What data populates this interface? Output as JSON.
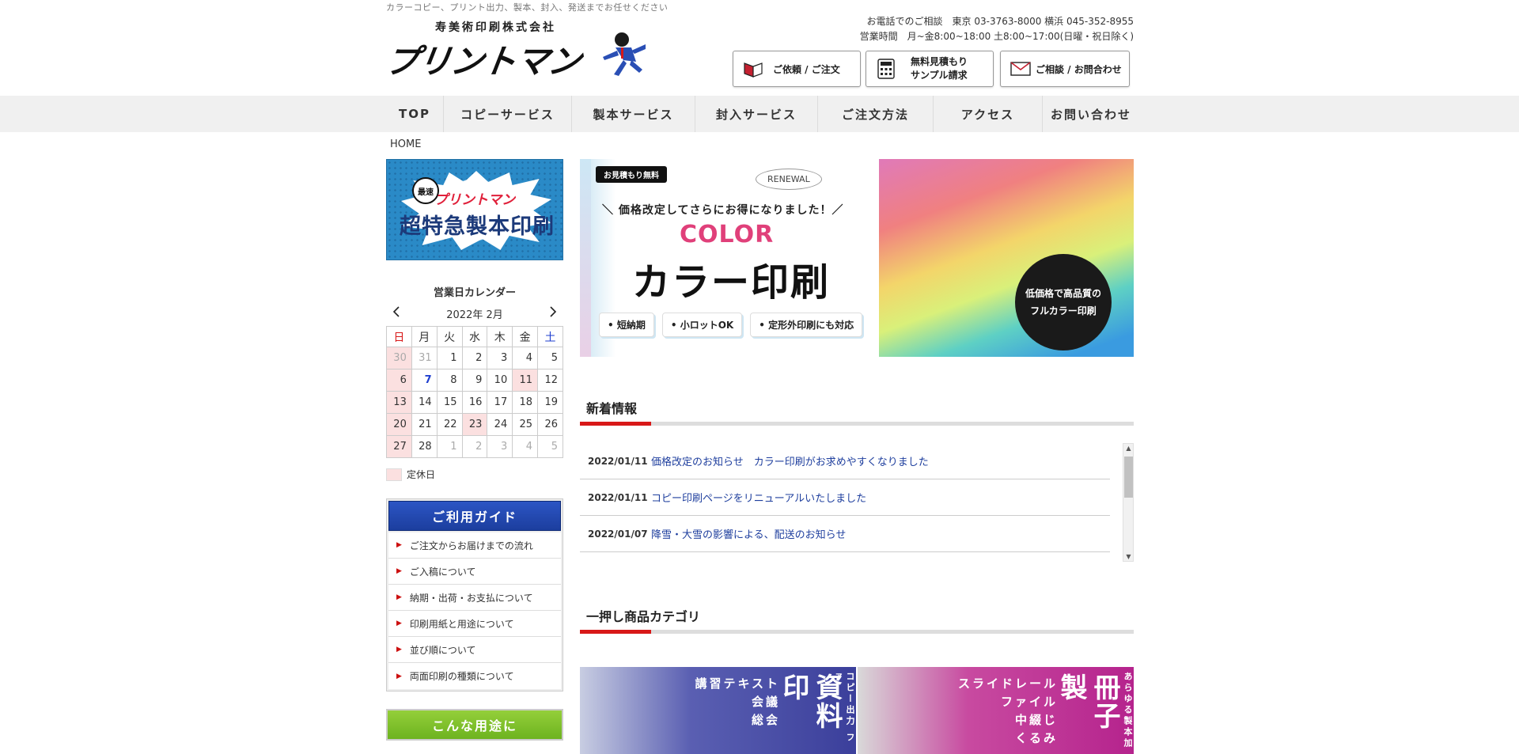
{
  "header": {
    "tagline": "カラーコピー、プリント出力、製本、封入、発送までお任せください",
    "company": "寿美術印刷株式会社",
    "logo": "プリントマン",
    "contact_line1": "お電話でのご相談　東京 03-3763-8000 横浜 045-352-8955",
    "contact_line2": "営業時間　月~金8:00~18:00 土8:00~17:00(日曜・祝日除く)",
    "btn_order": "ご依頼 / ご注文",
    "btn_estimate_1": "無料見積もり",
    "btn_estimate_2": "サンプル請求",
    "btn_contact": "ご相談 / お問合わせ"
  },
  "nav": {
    "items": [
      "TOP",
      "コピーサービス",
      "製本サービス",
      "封入サービス",
      "ご注文方法",
      "アクセス",
      "お問い合わせ"
    ]
  },
  "breadcrumb": "HOME",
  "sidebar": {
    "promo_badge": "最速",
    "promo_brand": "プリントマン",
    "promo_title": "超特急製本印刷",
    "calendar_title": "営業日カレンダー",
    "calendar_month": "2022年 2月",
    "weekdays": [
      "日",
      "月",
      "火",
      "水",
      "木",
      "金",
      "土"
    ],
    "weeks": [
      [
        "30",
        "31",
        "1",
        "2",
        "3",
        "4",
        "5"
      ],
      [
        "6",
        "7",
        "8",
        "9",
        "10",
        "11",
        "12"
      ],
      [
        "13",
        "14",
        "15",
        "16",
        "17",
        "18",
        "19"
      ],
      [
        "20",
        "21",
        "22",
        "23",
        "24",
        "25",
        "26"
      ],
      [
        "27",
        "28",
        "1",
        "2",
        "3",
        "4",
        "5"
      ]
    ],
    "legend": "定休日",
    "guide_title": "ご利用ガイド",
    "guide_items": [
      "ご注文からお届けまでの流れ",
      "ご入稿について",
      "納期・出荷・お支払について",
      "印刷用紙と用途について",
      "並び順について",
      "両面印刷の種類について"
    ],
    "use_title": "こんな用途に"
  },
  "hero": {
    "free": "お見積もり無料",
    "renewal": "RENEWAL",
    "line": "＼ 価格改定してさらにお得になりました！／",
    "color": "COLOR",
    "big": "カラー印刷",
    "tags": [
      "• 短納期",
      "• 小ロットOK",
      "• 定形外印刷にも対応"
    ],
    "circle_1": "低価格で高品質の",
    "circle_2": "フルカラー印刷"
  },
  "news": {
    "title": "新着情報",
    "items": [
      {
        "date": "2022/01/11",
        "text": "価格改定のお知らせ　カラー印刷がお求めやすくなりました"
      },
      {
        "date": "2022/01/11",
        "text": "コピー印刷ページをリニューアルいたしました"
      },
      {
        "date": "2022/01/07",
        "text": "降雪・大雪の影響による、配送のお知らせ"
      }
    ]
  },
  "categories": {
    "title": "一押し商品カテゴリ",
    "cat1_lines": [
      "講習テキスト",
      "会議",
      "総会"
    ],
    "cat1_big": "資料印",
    "cat1_vert": "コピー出力 ファ",
    "cat2_lines": [
      "スライドレール",
      "ファイル",
      "中綴じ",
      "くるみ"
    ],
    "cat2_big": "冊子製",
    "cat2_vert": "あらゆる製本加"
  },
  "colors": {
    "nav_bg": "#f0f0f0",
    "holiday": "#fbe0e0",
    "accent_red": "#d81818",
    "guide_blue": "#1c3e9e",
    "link_blue": "#1f3f9e",
    "use_green": "#7cbf27"
  }
}
